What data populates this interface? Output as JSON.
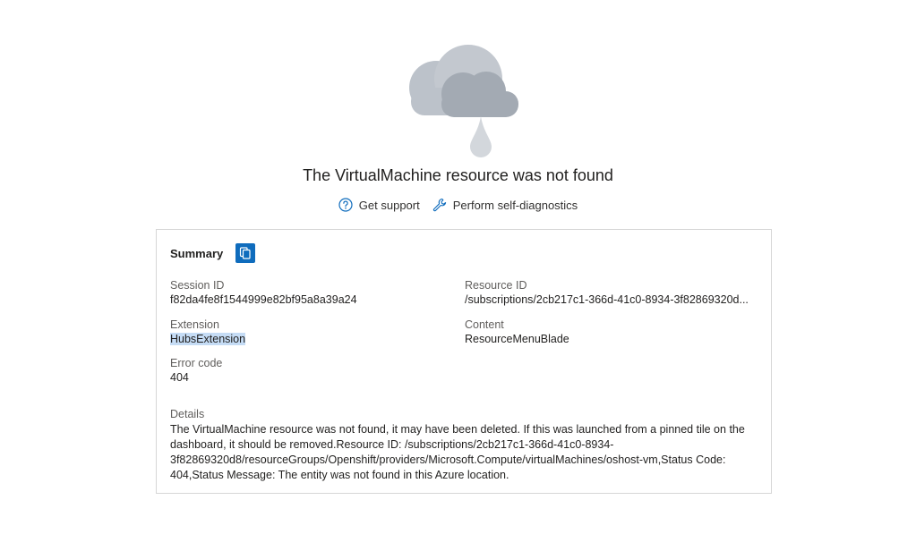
{
  "error": {
    "title": "The VirtualMachine resource was not found"
  },
  "links": {
    "support_label": "Get support",
    "diagnostics_label": "Perform self-diagnostics"
  },
  "summary": {
    "title": "Summary",
    "session_id": {
      "label": "Session ID",
      "value": "f82da4fe8f1544999e82bf95a8a39a24"
    },
    "resource_id": {
      "label": "Resource ID",
      "value": "/subscriptions/2cb217c1-366d-41c0-8934-3f82869320d..."
    },
    "extension": {
      "label": "Extension",
      "value": "HubsExtension"
    },
    "content": {
      "label": "Content",
      "value": "ResourceMenuBlade"
    },
    "error_code": {
      "label": "Error code",
      "value": "404"
    },
    "details": {
      "label": "Details",
      "value": "The VirtualMachine resource was not found, it may have been deleted. If this was launched from a pinned tile on the dashboard, it should be removed.Resource ID: /subscriptions/2cb217c1-366d-41c0-8934-3f82869320d8/resourceGroups/Openshift/providers/Microsoft.Compute/virtualMachines/oshost-vm,Status Code: 404,Status Message: The entity was not found in this Azure location."
    }
  },
  "icons": {
    "illustration": "cloud-rain-icon",
    "support": "question-circle-icon",
    "diagnostics": "wrench-icon",
    "copy": "copy-icon"
  },
  "colors": {
    "accent": "#0f6cbd",
    "cloud_light": "#b9bfc7",
    "cloud_dark": "#a1a8b1",
    "selection": "#c5dcf5"
  }
}
